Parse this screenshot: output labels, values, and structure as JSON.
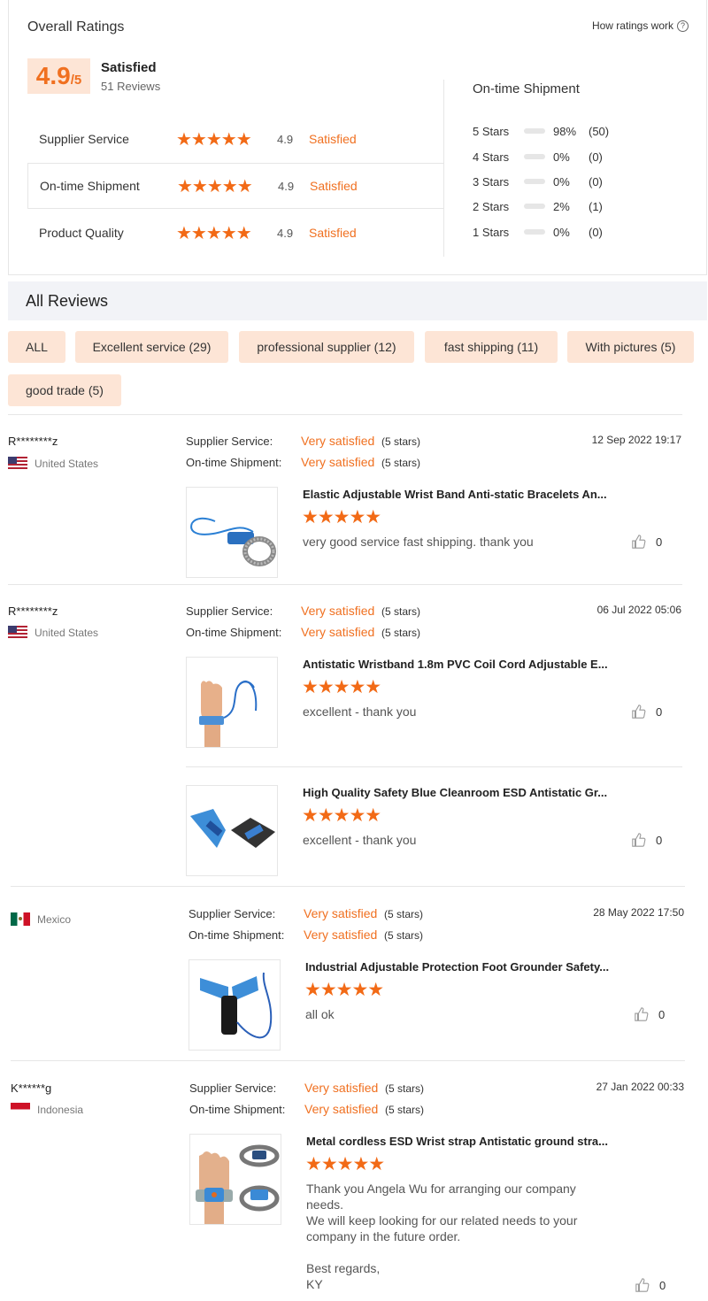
{
  "overall": {
    "title": "Overall Ratings",
    "how_link": "How ratings work",
    "score": "4.9",
    "score_suffix": "/5",
    "label": "Satisfied",
    "count": "51 Reviews",
    "rows": [
      {
        "label": "Supplier Service",
        "stars": "★★★★★",
        "value": "4.9",
        "status": "Satisfied"
      },
      {
        "label": "On-time Shipment",
        "stars": "★★★★★",
        "value": "4.9",
        "status": "Satisfied"
      },
      {
        "label": "Product Quality",
        "stars": "★★★★★",
        "value": "4.9",
        "status": "Satisfied"
      }
    ],
    "shipment": {
      "title": "On-time Shipment",
      "distribution": [
        {
          "label": "5 Stars",
          "pct": "98%",
          "count": "(50)",
          "fill": 0.98
        },
        {
          "label": "4 Stars",
          "pct": "0%",
          "count": "(0)",
          "fill": 0
        },
        {
          "label": "3 Stars",
          "pct": "0%",
          "count": "(0)",
          "fill": 0
        },
        {
          "label": "2 Stars",
          "pct": "2%",
          "count": "(1)",
          "fill": 0.02
        },
        {
          "label": "1 Stars",
          "pct": "0%",
          "count": "(0)",
          "fill": 0
        }
      ]
    }
  },
  "all_reviews": {
    "title": "All Reviews",
    "tags": [
      "ALL",
      "Excellent service (29)",
      "professional supplier (12)",
      "fast shipping (11)",
      "With pictures (5)",
      "good trade (5)"
    ]
  },
  "labels": {
    "supplier_service": "Supplier Service:",
    "on_time_shipment": "On-time Shipment:",
    "very_satisfied": "Very satisfied",
    "five_stars": "(5 stars)",
    "stars": "★★★★★"
  },
  "reviews": [
    {
      "name": "R********z",
      "country": "United States",
      "date": "12 Sep 2022 19:17",
      "products": [
        {
          "title": "Elastic Adjustable Wrist Band Anti-static Bracelets An...",
          "text": "very good service fast shipping. thank you",
          "likes": "0"
        }
      ]
    },
    {
      "name": "R********z",
      "country": "United States",
      "date": "06 Jul 2022 05:06",
      "products": [
        {
          "title": "Antistatic Wristband 1.8m PVC Coil Cord Adjustable E...",
          "text": "excellent - thank you",
          "likes": "0"
        },
        {
          "title": "High Quality Safety Blue Cleanroom ESD Antistatic Gr...",
          "text": "excellent - thank you",
          "likes": "0"
        }
      ]
    },
    {
      "name": "",
      "country": "Mexico",
      "date": "28 May 2022 17:50",
      "products": [
        {
          "title": "Industrial Adjustable Protection Foot Grounder Safety...",
          "text": "all ok",
          "likes": "0"
        }
      ]
    },
    {
      "name": "K******g",
      "country": "Indonesia",
      "date": "27  Jan 2022 00:33",
      "products": [
        {
          "title": "Metal cordless ESD Wrist strap Antistatic ground stra...",
          "text": "Thank you Angela Wu for arranging our company needs.\nWe will keep looking for our related needs to your company in the future order.\n\nBest regards,\nKY",
          "likes": "0"
        }
      ]
    }
  ],
  "colors": {
    "accent": "#f26a16",
    "accent_bg": "#fde5d6",
    "divider": "#e6e6e6"
  }
}
